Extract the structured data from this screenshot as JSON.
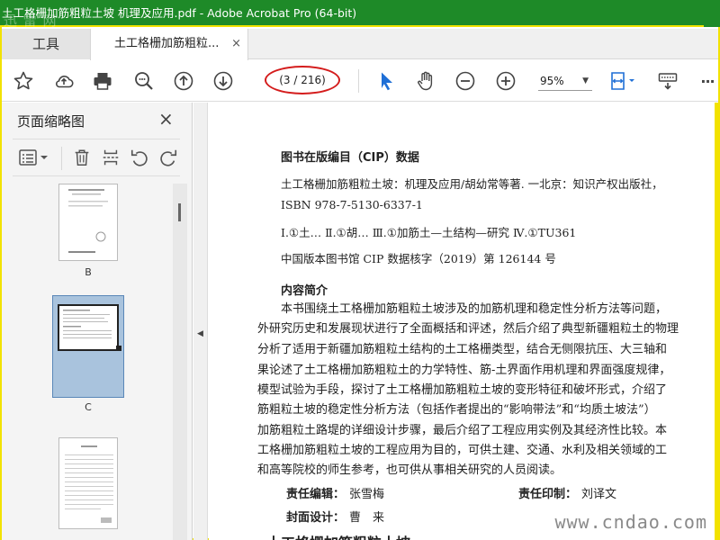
{
  "window": {
    "title": "土工格栅加筋粗粒土坡 机理及应用.pdf - Adobe Acrobat Pro (64-bit)",
    "logo_text": "迅 雷 网"
  },
  "tabs": {
    "tools_label": "工具",
    "doc_label": "土工格栅加筋粗粒...",
    "close_glyph": "×"
  },
  "toolbar": {
    "page_indicator": "(3 / 216)",
    "zoom": "95%",
    "more_glyph": "···"
  },
  "sidebar": {
    "title": "页面缩略图",
    "close_glyph": "×",
    "thumbnails": [
      {
        "label": "B"
      },
      {
        "label": "C"
      }
    ]
  },
  "page": {
    "cip_heading": "图书在版编目（CIP）数据",
    "cip_line1": "土工格栅加筋粗粒土坡：机理及应用/胡幼常等著. 一北京：知识产权出版社，",
    "isbn": "ISBN 978-7-5130-6337-1",
    "classification": "Ⅰ.①土…  Ⅱ.①胡…  Ⅲ.①加筋土—土结构—研究  Ⅳ.①TU361",
    "cip_number": "中国版本图书馆 CIP 数据核字（2019）第 126144 号",
    "summary_heading": "内容简介",
    "summary_lines": [
      "本书围绕土工格栅加筋粗粒土坡涉及的加筋机理和稳定性分析方法等问题，",
      "外研究历史和发展现状进行了全面概括和评述，然后介绍了典型新疆粗粒土的物理",
      "分析了适用于新疆加筋粗粒土结构的土工格栅类型，结合无侧限抗压、大三轴和",
      "果论述了土工格栅加筋粗粒土的力学特性、筋-土界面作用机理和界面强度规律，",
      "模型试验为手段，探讨了土工格栅加筋粗粒土坡的变形特征和破坏形式，介绍了",
      "筋粗粒土坡的稳定性分析方法（包括作者提出的“影响带法”和“均质土坡法”）",
      "加筋粗粒土路堤的详细设计步骤，最后介绍了工程应用实例及其经济性比较。本",
      "工格栅加筋粗粒土坡的工程应用为目的，可供土建、交通、水利及相关领域的工",
      "和高等院校的师生参考，也可供从事相关研究的人员阅读。"
    ],
    "editor_label": "责任编辑：",
    "editor_name": "张雪梅",
    "print_label": "责任印制：",
    "print_name": "刘译文",
    "cover_label": "封面设计：",
    "cover_name": "曹　来",
    "bottom_partial": "土工格栅加筋粗粒土坡",
    "watermark": "www.cndao.com"
  },
  "colors": {
    "titlebar": "#1e8a28",
    "frame": "#f2e200",
    "oval": "#d41c1c",
    "select_arrow": "#1f6fd6"
  }
}
